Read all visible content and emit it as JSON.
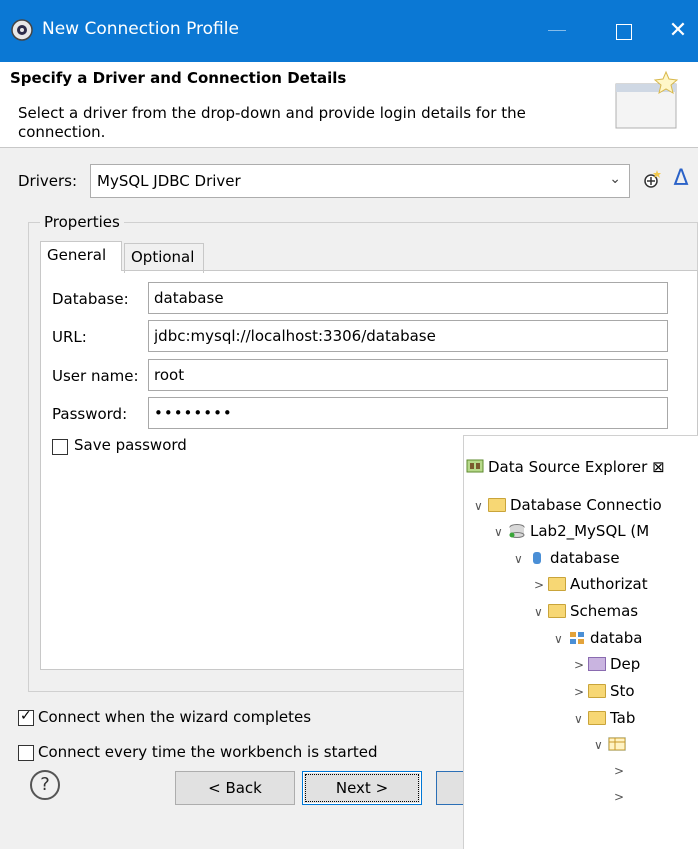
{
  "window": {
    "title": "New Connection Profile",
    "minimize": "—",
    "close": "✕"
  },
  "header": {
    "title": "Specify a Driver and Connection Details",
    "description": "Select a driver from the drop-down and provide login details for the connection."
  },
  "drivers": {
    "label": "Drivers:",
    "value": "MySQL JDBC Driver",
    "chevron": "⌄",
    "edit_icon": "Δ"
  },
  "properties": {
    "legend": "Properties",
    "tabs": [
      {
        "label": "General"
      },
      {
        "label": "Optional"
      }
    ],
    "fields": {
      "database": {
        "label": "Database:",
        "value": "database"
      },
      "url": {
        "label": "URL:",
        "value": "jdbc:mysql://localhost:3306/database"
      },
      "username": {
        "label": "User name:",
        "value": "root"
      },
      "password": {
        "label": "Password:",
        "value": "••••••••"
      }
    },
    "save_password": {
      "label": "Save password",
      "checked": false
    }
  },
  "options": {
    "connect_on_finish": {
      "label": "Connect when the wizard completes",
      "checked": true
    },
    "connect_on_start": {
      "label": "Connect every time the workbench is started",
      "checked": false
    }
  },
  "buttons": {
    "help": "?",
    "back": "< Back",
    "next": "Next >"
  },
  "explorer": {
    "title": "Data Source Explorer ⊠",
    "tree": [
      {
        "label": "Database Connectio",
        "twisty": "∨"
      },
      {
        "label": "Lab2_MySQL (M",
        "twisty": "∨"
      },
      {
        "label": "database",
        "twisty": "∨"
      },
      {
        "label": "Authorizat",
        "twisty": ">"
      },
      {
        "label": "Schemas",
        "twisty": "∨"
      },
      {
        "label": "databa",
        "twisty": "∨"
      },
      {
        "label": "Dep",
        "twisty": ">"
      },
      {
        "label": "Sto",
        "twisty": ">"
      },
      {
        "label": "Tab",
        "twisty": "∨"
      },
      {
        "label": "",
        "twisty": "∨"
      },
      {
        "label": "",
        "twisty": ">"
      },
      {
        "label": "",
        "twisty": ">"
      }
    ]
  }
}
